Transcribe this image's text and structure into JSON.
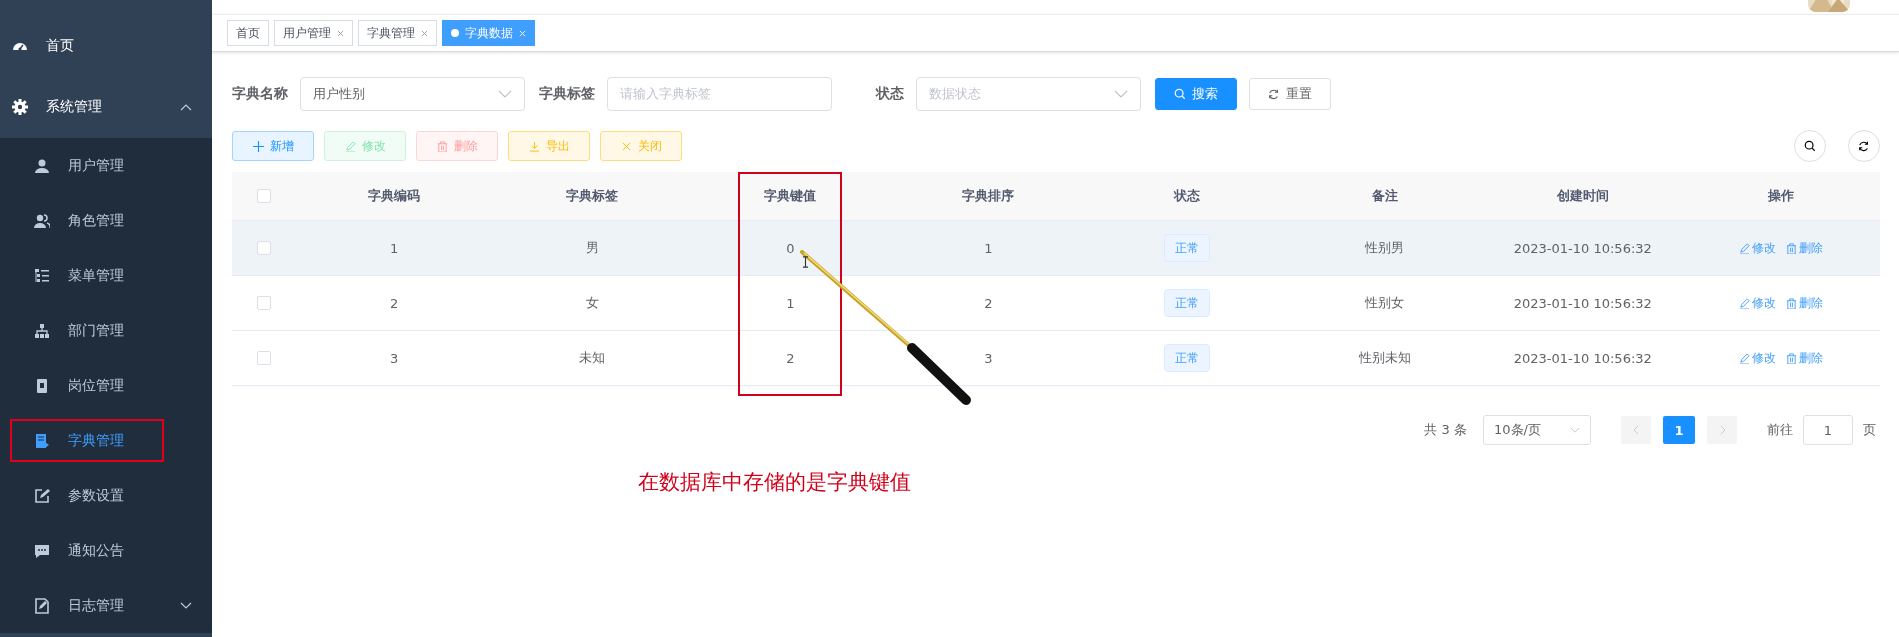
{
  "sidebar": {
    "items": [
      {
        "label": "首页",
        "selected": false
      },
      {
        "label": "系统管理",
        "expanded": true,
        "children": [
          {
            "label": "用户管理",
            "selected": false,
            "annotated": false
          },
          {
            "label": "角色管理",
            "selected": false,
            "annotated": false
          },
          {
            "label": "菜单管理",
            "selected": false,
            "annotated": false
          },
          {
            "label": "部门管理",
            "selected": false,
            "annotated": false
          },
          {
            "label": "岗位管理",
            "selected": false,
            "annotated": false
          },
          {
            "label": "字典管理",
            "selected": true,
            "annotated": true
          },
          {
            "label": "参数设置",
            "selected": false,
            "annotated": false
          },
          {
            "label": "通知公告",
            "selected": false,
            "annotated": false
          },
          {
            "label": "日志管理",
            "selected": false,
            "annotated": false,
            "expanded": false
          }
        ]
      }
    ]
  },
  "tabs": [
    {
      "label": "首页",
      "selected": false,
      "closable": false
    },
    {
      "label": "用户管理",
      "selected": false,
      "closable": true
    },
    {
      "label": "字典管理",
      "selected": false,
      "closable": true
    },
    {
      "label": "字典数据",
      "selected": true,
      "closable": true
    }
  ],
  "filters": [
    {
      "label": "字典名称",
      "kind": "select",
      "value": "用户性别"
    },
    {
      "label": "字典标签",
      "kind": "input",
      "placeholder": "请输入字典标签"
    },
    {
      "label": "状态",
      "kind": "select",
      "placeholder": "数据状态"
    }
  ],
  "filter_buttons": [
    {
      "label": "搜索",
      "kind": "search"
    },
    {
      "label": "重置",
      "kind": "reset"
    }
  ],
  "toolbar": [
    {
      "label": "新增",
      "kind": "add",
      "disabled": false
    },
    {
      "label": "修改",
      "kind": "edit",
      "disabled": true
    },
    {
      "label": "删除",
      "kind": "delete",
      "disabled": true
    },
    {
      "label": "导出",
      "kind": "export",
      "disabled": false
    },
    {
      "label": "关闭",
      "kind": "close",
      "disabled": false
    }
  ],
  "table": {
    "all_checked": false,
    "columns": [
      {
        "label": "字典编码",
        "annotated": false
      },
      {
        "label": "字典标签",
        "annotated": false
      },
      {
        "label": "字典键值",
        "annotated": true
      },
      {
        "label": "字典排序",
        "annotated": false
      },
      {
        "label": "状态",
        "annotated": false
      },
      {
        "label": "备注",
        "annotated": false
      },
      {
        "label": "创建时间",
        "annotated": false
      },
      {
        "label": "操作",
        "annotated": false
      }
    ],
    "rows": [
      {
        "checked": false,
        "hovered": true,
        "code": "1",
        "label": "男",
        "value": "0",
        "sort": "1",
        "status": "正常",
        "remark": "性别男",
        "created": "2023-01-10 10:56:32",
        "actions": [
          "修改",
          "删除"
        ]
      },
      {
        "checked": false,
        "hovered": false,
        "code": "2",
        "label": "女",
        "value": "1",
        "sort": "2",
        "status": "正常",
        "remark": "性别女",
        "created": "2023-01-10 10:56:32",
        "actions": [
          "修改",
          "删除"
        ]
      },
      {
        "checked": false,
        "hovered": false,
        "code": "3",
        "label": "未知",
        "value": "2",
        "sort": "3",
        "status": "正常",
        "remark": "性别未知",
        "created": "2023-01-10 10:56:32",
        "actions": [
          "修改",
          "删除"
        ]
      }
    ]
  },
  "pagination": {
    "total": "共 3 条",
    "page_size": "10条/页",
    "pages": [
      {
        "label": "1",
        "selected": true
      }
    ],
    "goto_label": "前往",
    "goto_value": "1",
    "goto_suffix": "页"
  },
  "annotation": {
    "text": "在数据库中存储的是字典键值"
  }
}
